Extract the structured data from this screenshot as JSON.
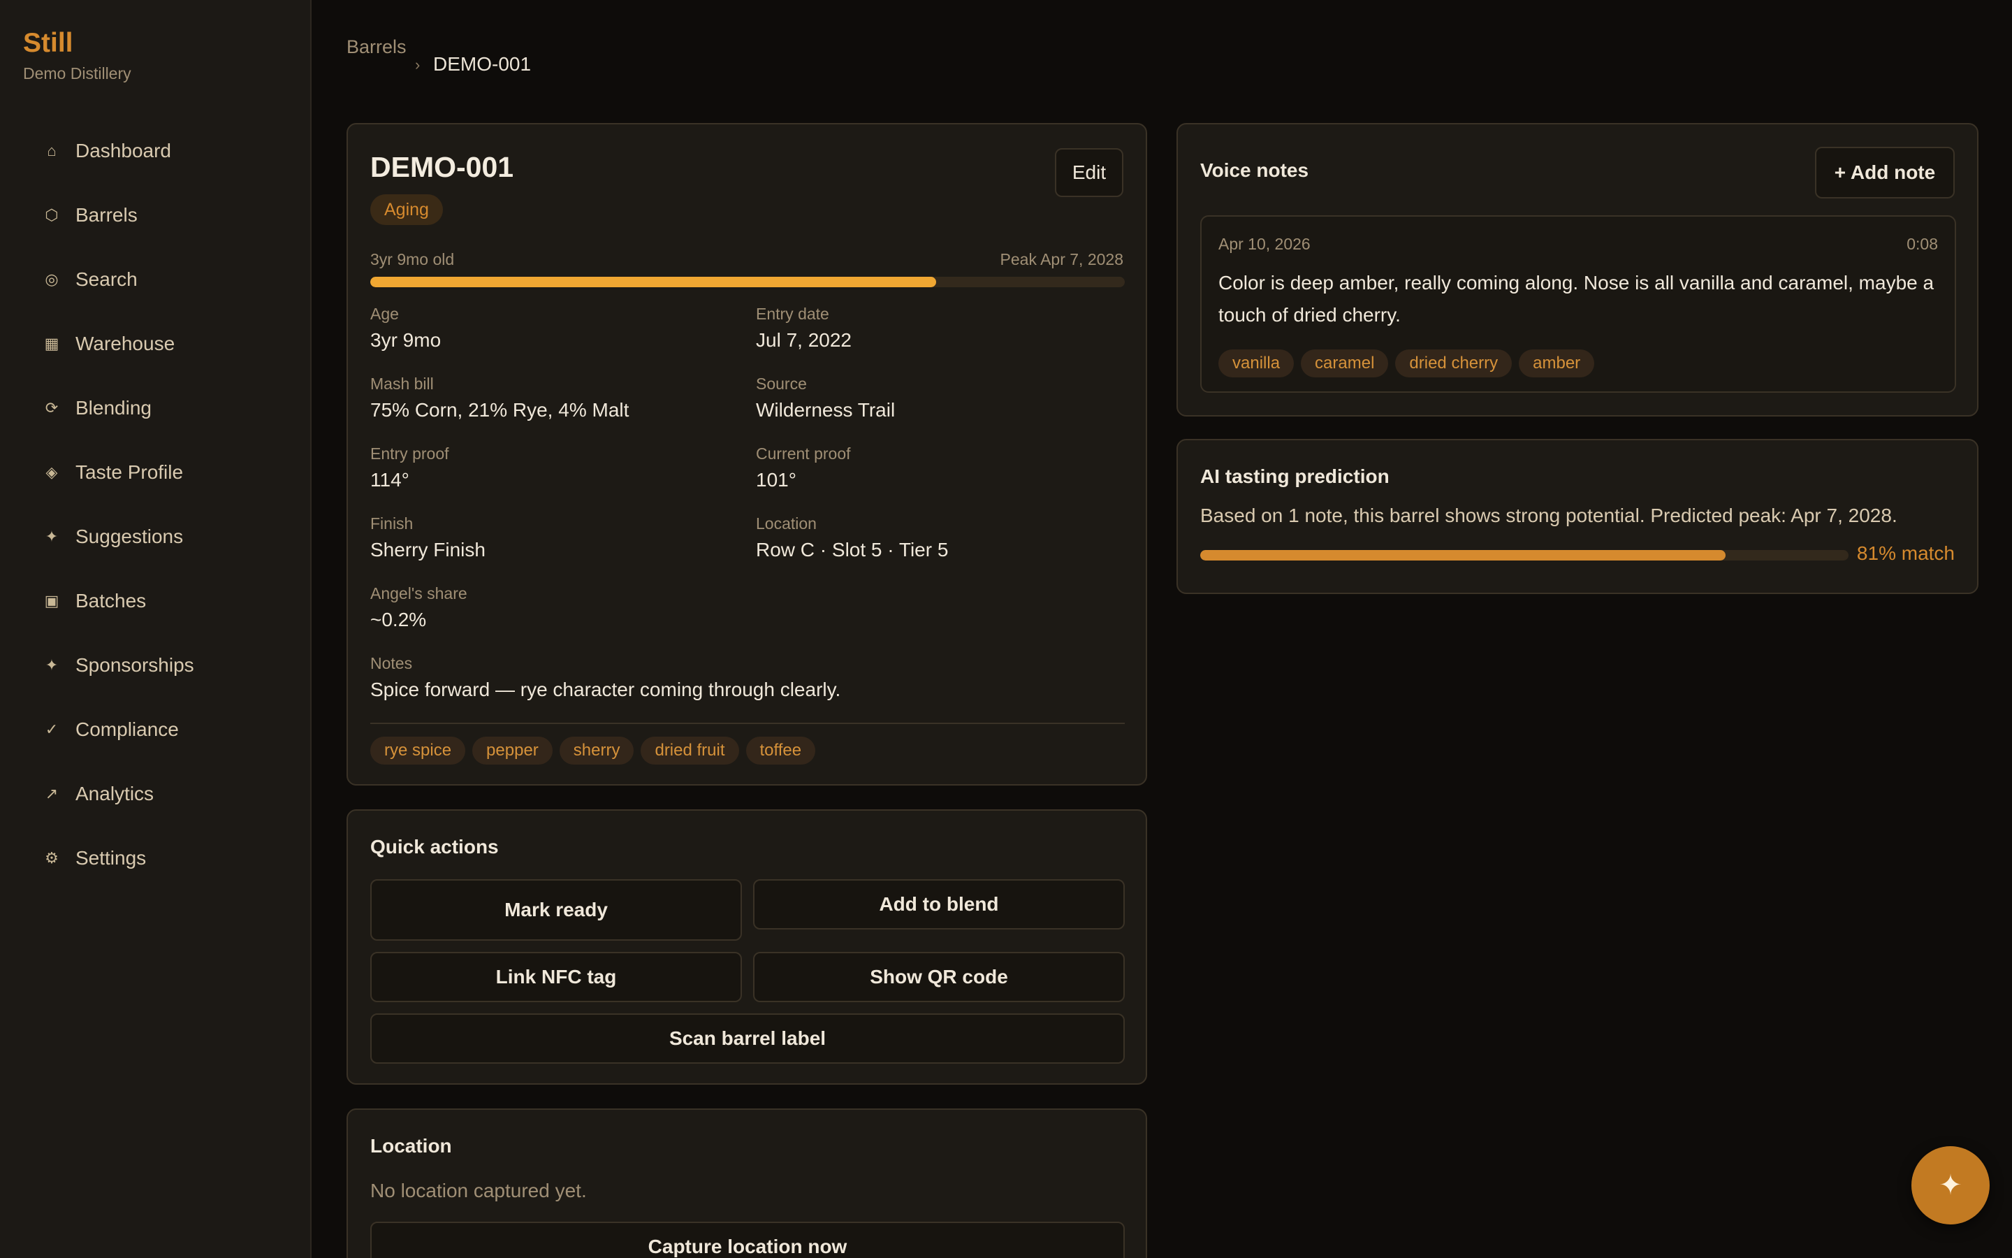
{
  "brand": {
    "name": "Still",
    "subtitle": "Demo Distillery"
  },
  "nav": [
    {
      "icon": "⌂",
      "label": "Dashboard"
    },
    {
      "icon": "⬡",
      "label": "Barrels"
    },
    {
      "icon": "◎",
      "label": "Search"
    },
    {
      "icon": "▦",
      "label": "Warehouse"
    },
    {
      "icon": "⟳",
      "label": "Blending"
    },
    {
      "icon": "◈",
      "label": "Taste Profile"
    },
    {
      "icon": "✦",
      "label": "Suggestions"
    },
    {
      "icon": "▣",
      "label": "Batches"
    },
    {
      "icon": "✦",
      "label": "Sponsorships"
    },
    {
      "icon": "✓",
      "label": "Compliance"
    },
    {
      "icon": "↗",
      "label": "Analytics"
    },
    {
      "icon": "⚙",
      "label": "Settings"
    }
  ],
  "breadcrumb": {
    "root": "Barrels",
    "separator": "›",
    "current": "DEMO-001"
  },
  "barrel": {
    "id": "DEMO-001",
    "edit_label": "Edit",
    "status": "Aging",
    "age_caption": "3yr 9mo old",
    "peak_caption": "Peak Apr 7, 2028",
    "progress_fraction": 0.75,
    "fields": {
      "age": {
        "label": "Age",
        "value": "3yr 9mo"
      },
      "entry_date": {
        "label": "Entry date",
        "value": "Jul 7, 2022"
      },
      "mash_bill": {
        "label": "Mash bill",
        "value": "75% Corn, 21% Rye, 4% Malt"
      },
      "source": {
        "label": "Source",
        "value": "Wilderness Trail"
      },
      "entry_proof": {
        "label": "Entry proof",
        "value": "114°"
      },
      "current_proof": {
        "label": "Current proof",
        "value": "101°"
      },
      "finish": {
        "label": "Finish",
        "value": "Sherry Finish"
      },
      "location": {
        "label": "Location",
        "value": "Row C · Slot 5 · Tier 5"
      },
      "angels_share": {
        "label": "Angel's share",
        "value": "~0.2%"
      },
      "notes": {
        "label": "Notes",
        "value": "Spice forward — rye character coming through clearly."
      }
    },
    "tags": [
      "rye spice",
      "pepper",
      "sherry",
      "dried fruit",
      "toffee"
    ]
  },
  "quick_actions": {
    "title": "Quick actions",
    "mark_ready": "Mark ready",
    "add_to_blend": "Add to blend",
    "link_nfc": "Link NFC tag",
    "show_qr": "Show QR code",
    "scan_label": "Scan barrel label"
  },
  "location_card": {
    "title": "Location",
    "empty_text": "No location captured yet.",
    "capture_label": "Capture location now"
  },
  "voice_notes": {
    "title": "Voice notes",
    "add_label": "+ Add note",
    "note": {
      "date": "Apr 10, 2026",
      "duration": "0:08",
      "text": "Color is deep amber, really coming along. Nose is all vanilla and caramel, maybe a touch of dried cherry.",
      "tags": [
        "vanilla",
        "caramel",
        "dried cherry",
        "amber"
      ]
    }
  },
  "ai_prediction": {
    "title": "AI tasting prediction",
    "text": "Based on 1 note, this barrel shows strong potential. Predicted peak: Apr 7, 2028.",
    "match_fraction": 0.81,
    "match_label": "81% match"
  },
  "fab_icon": "✦",
  "colors": {
    "accent": "#d68a2e",
    "progress": "#f0a732",
    "background": "#0e0c0a",
    "sidebar": "#1c1915",
    "card": "#1d1a15"
  }
}
